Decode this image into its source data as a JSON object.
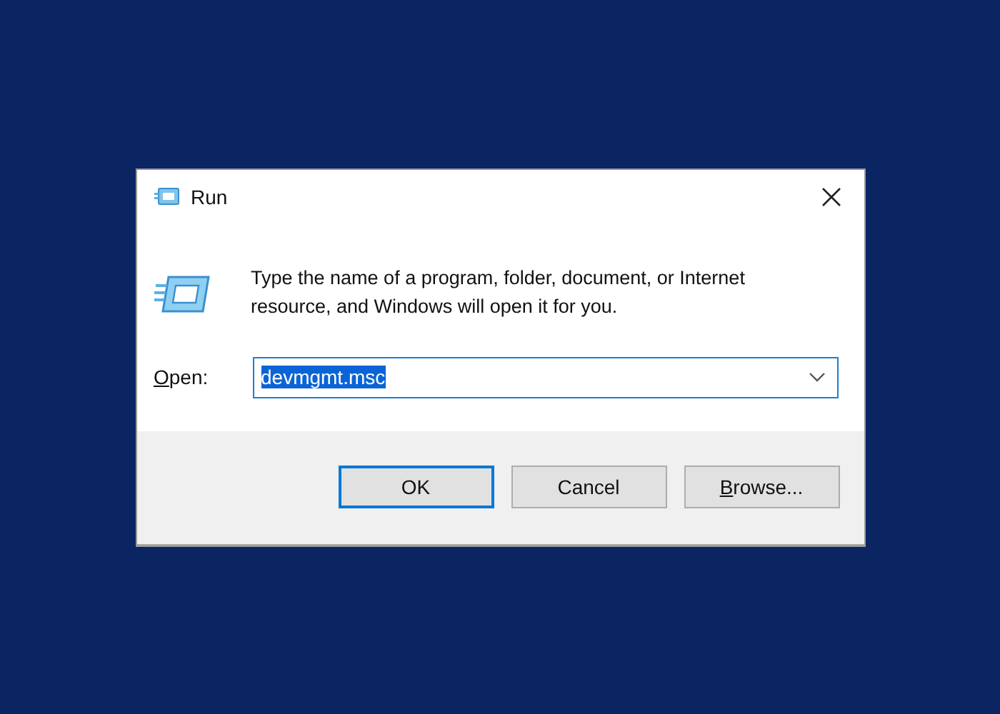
{
  "window": {
    "title": "Run"
  },
  "message": "Type the name of a program, folder, document, or Internet resource, and Windows will open it for you.",
  "open_field": {
    "label_mnemonic": "O",
    "label_rest": "pen:",
    "value": "devmgmt.msc",
    "text_selected": true
  },
  "buttons": [
    {
      "label": "OK",
      "focused": true
    },
    {
      "label": "Cancel",
      "focused": false
    },
    {
      "label": "rowse...",
      "mnemonic": "B",
      "focused": false
    }
  ]
}
